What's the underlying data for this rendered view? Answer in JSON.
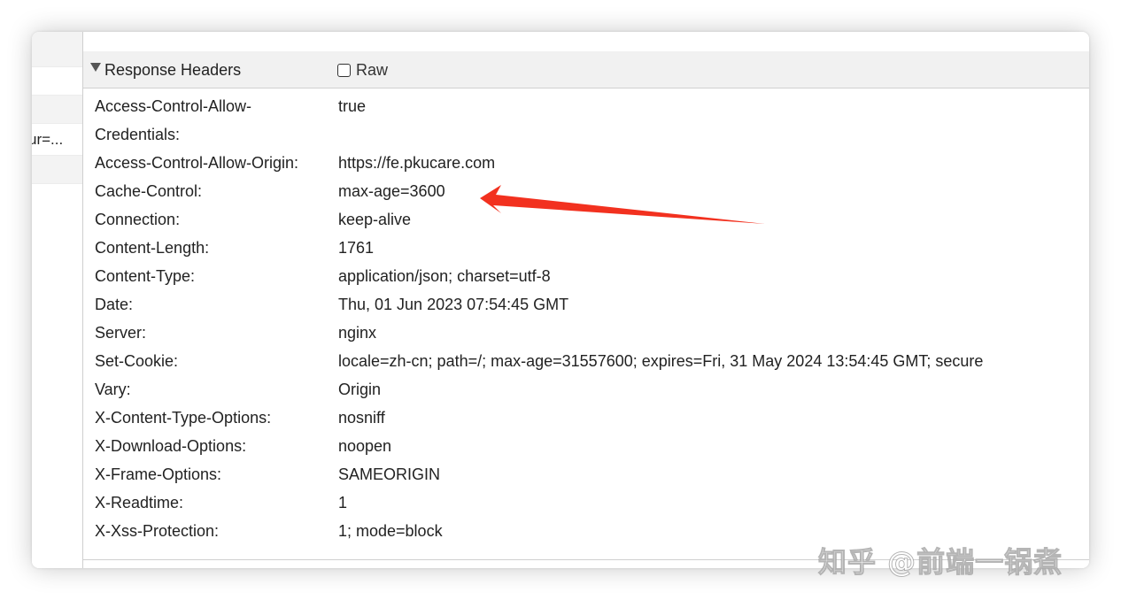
{
  "sidebar": {
    "truncated_item": "ur=..."
  },
  "section": {
    "title": "Response Headers",
    "raw_label": "Raw"
  },
  "headers": [
    {
      "name": "Access-Control-Allow-Credentials:",
      "value": "true"
    },
    {
      "name": "Access-Control-Allow-Origin:",
      "value": "https://fe.pkucare.com"
    },
    {
      "name": "Cache-Control:",
      "value": "max-age=3600"
    },
    {
      "name": "Connection:",
      "value": "keep-alive"
    },
    {
      "name": "Content-Length:",
      "value": "1761"
    },
    {
      "name": "Content-Type:",
      "value": "application/json; charset=utf-8"
    },
    {
      "name": "Date:",
      "value": "Thu, 01 Jun 2023 07:54:45 GMT"
    },
    {
      "name": "Server:",
      "value": "nginx"
    },
    {
      "name": "Set-Cookie:",
      "value": "locale=zh-cn; path=/; max-age=31557600; expires=Fri, 31 May 2024 13:54:45 GMT; secure"
    },
    {
      "name": "Vary:",
      "value": "Origin"
    },
    {
      "name": "X-Content-Type-Options:",
      "value": "nosniff"
    },
    {
      "name": "X-Download-Options:",
      "value": "noopen"
    },
    {
      "name": "X-Frame-Options:",
      "value": "SAMEORIGIN"
    },
    {
      "name": "X-Readtime:",
      "value": "1"
    },
    {
      "name": "X-Xss-Protection:",
      "value": "1; mode=block"
    }
  ],
  "annotation": {
    "arrow_color": "#f2311f"
  },
  "watermark": "知乎 @前端一锅煮"
}
